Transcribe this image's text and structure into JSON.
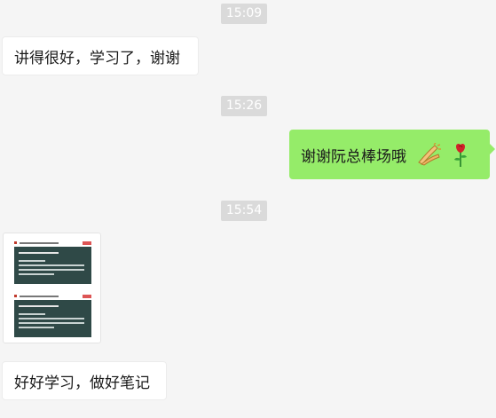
{
  "chat": {
    "timestamps": [
      "15:09",
      "15:26",
      "15:54"
    ],
    "messages": [
      {
        "direction": "incoming",
        "text": "讲得很好，学习了，谢谢"
      },
      {
        "direction": "outgoing",
        "text": "谢谢阮总棒场哦",
        "emojis": [
          "clapping-hands",
          "rose"
        ]
      },
      {
        "direction": "incoming",
        "type": "image",
        "content": "slides-screenshot"
      },
      {
        "direction": "incoming",
        "text": "好好学习，做好笔记"
      }
    ]
  },
  "colors": {
    "background": "#f5f5f5",
    "incoming_bubble": "#ffffff",
    "outgoing_bubble": "#95ec69",
    "timestamp_bg": "#dadada",
    "timestamp_text": "#ffffff"
  }
}
